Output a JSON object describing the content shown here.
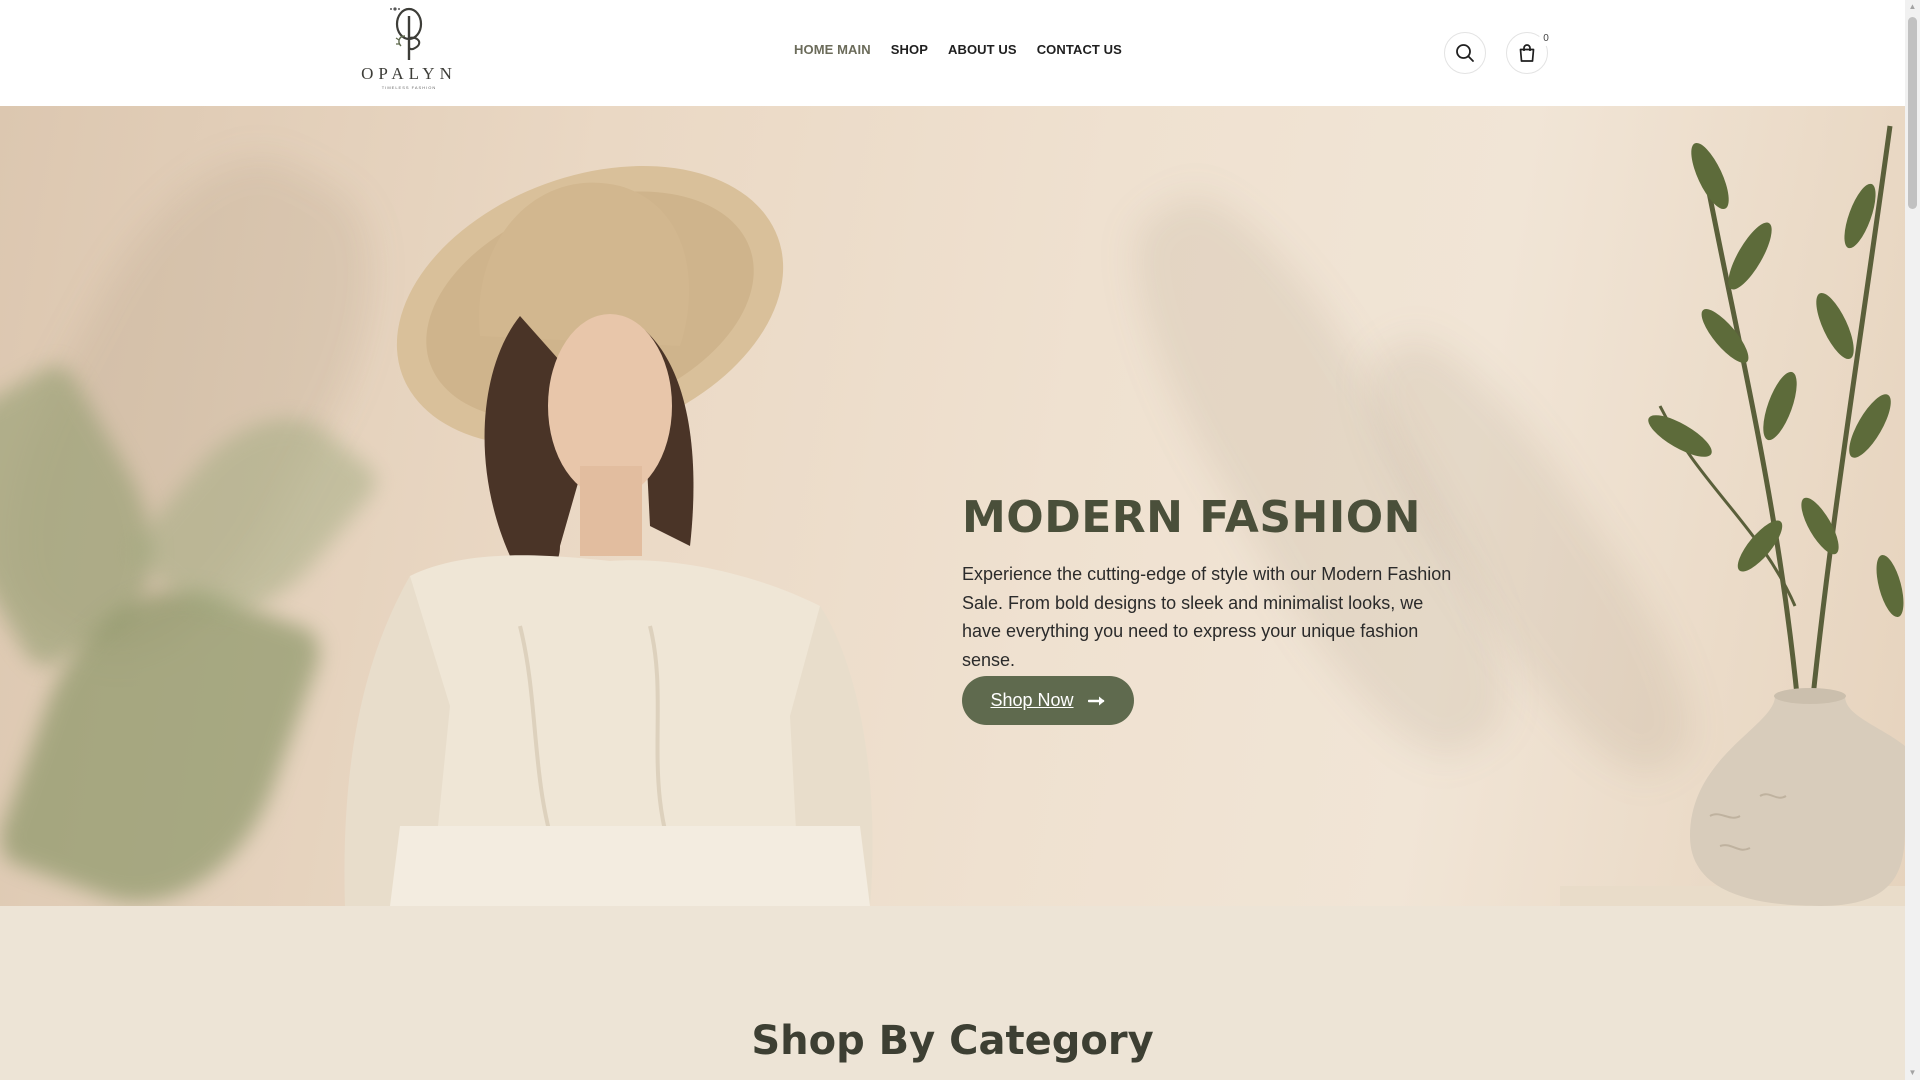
{
  "brand": {
    "name": "OPALYN",
    "tagline": "TIMELESS FASHION"
  },
  "nav": {
    "items": [
      {
        "label": "HOME MAIN",
        "active": true
      },
      {
        "label": "SHOP",
        "active": false
      },
      {
        "label": "ABOUT US",
        "active": false
      },
      {
        "label": "CONTACT US",
        "active": false
      }
    ]
  },
  "header_actions": {
    "search_icon": "search-icon",
    "cart_icon": "shopping-bag-icon",
    "cart_count": "0"
  },
  "hero": {
    "title": "MODERN FASHION",
    "description": "Experience the cutting-edge of style with our Modern Fashion Sale. From bold designs to sleek and minimalist looks, we have everything you need to express your unique fashion sense.",
    "button_label": "Shop Now",
    "button_icon": "arrow-right-icon"
  },
  "category_section": {
    "title": "Shop By Category"
  },
  "colors": {
    "accent": "#5f6a4e",
    "heading": "#4a4f3a",
    "section_bg": "#ede4d6"
  }
}
